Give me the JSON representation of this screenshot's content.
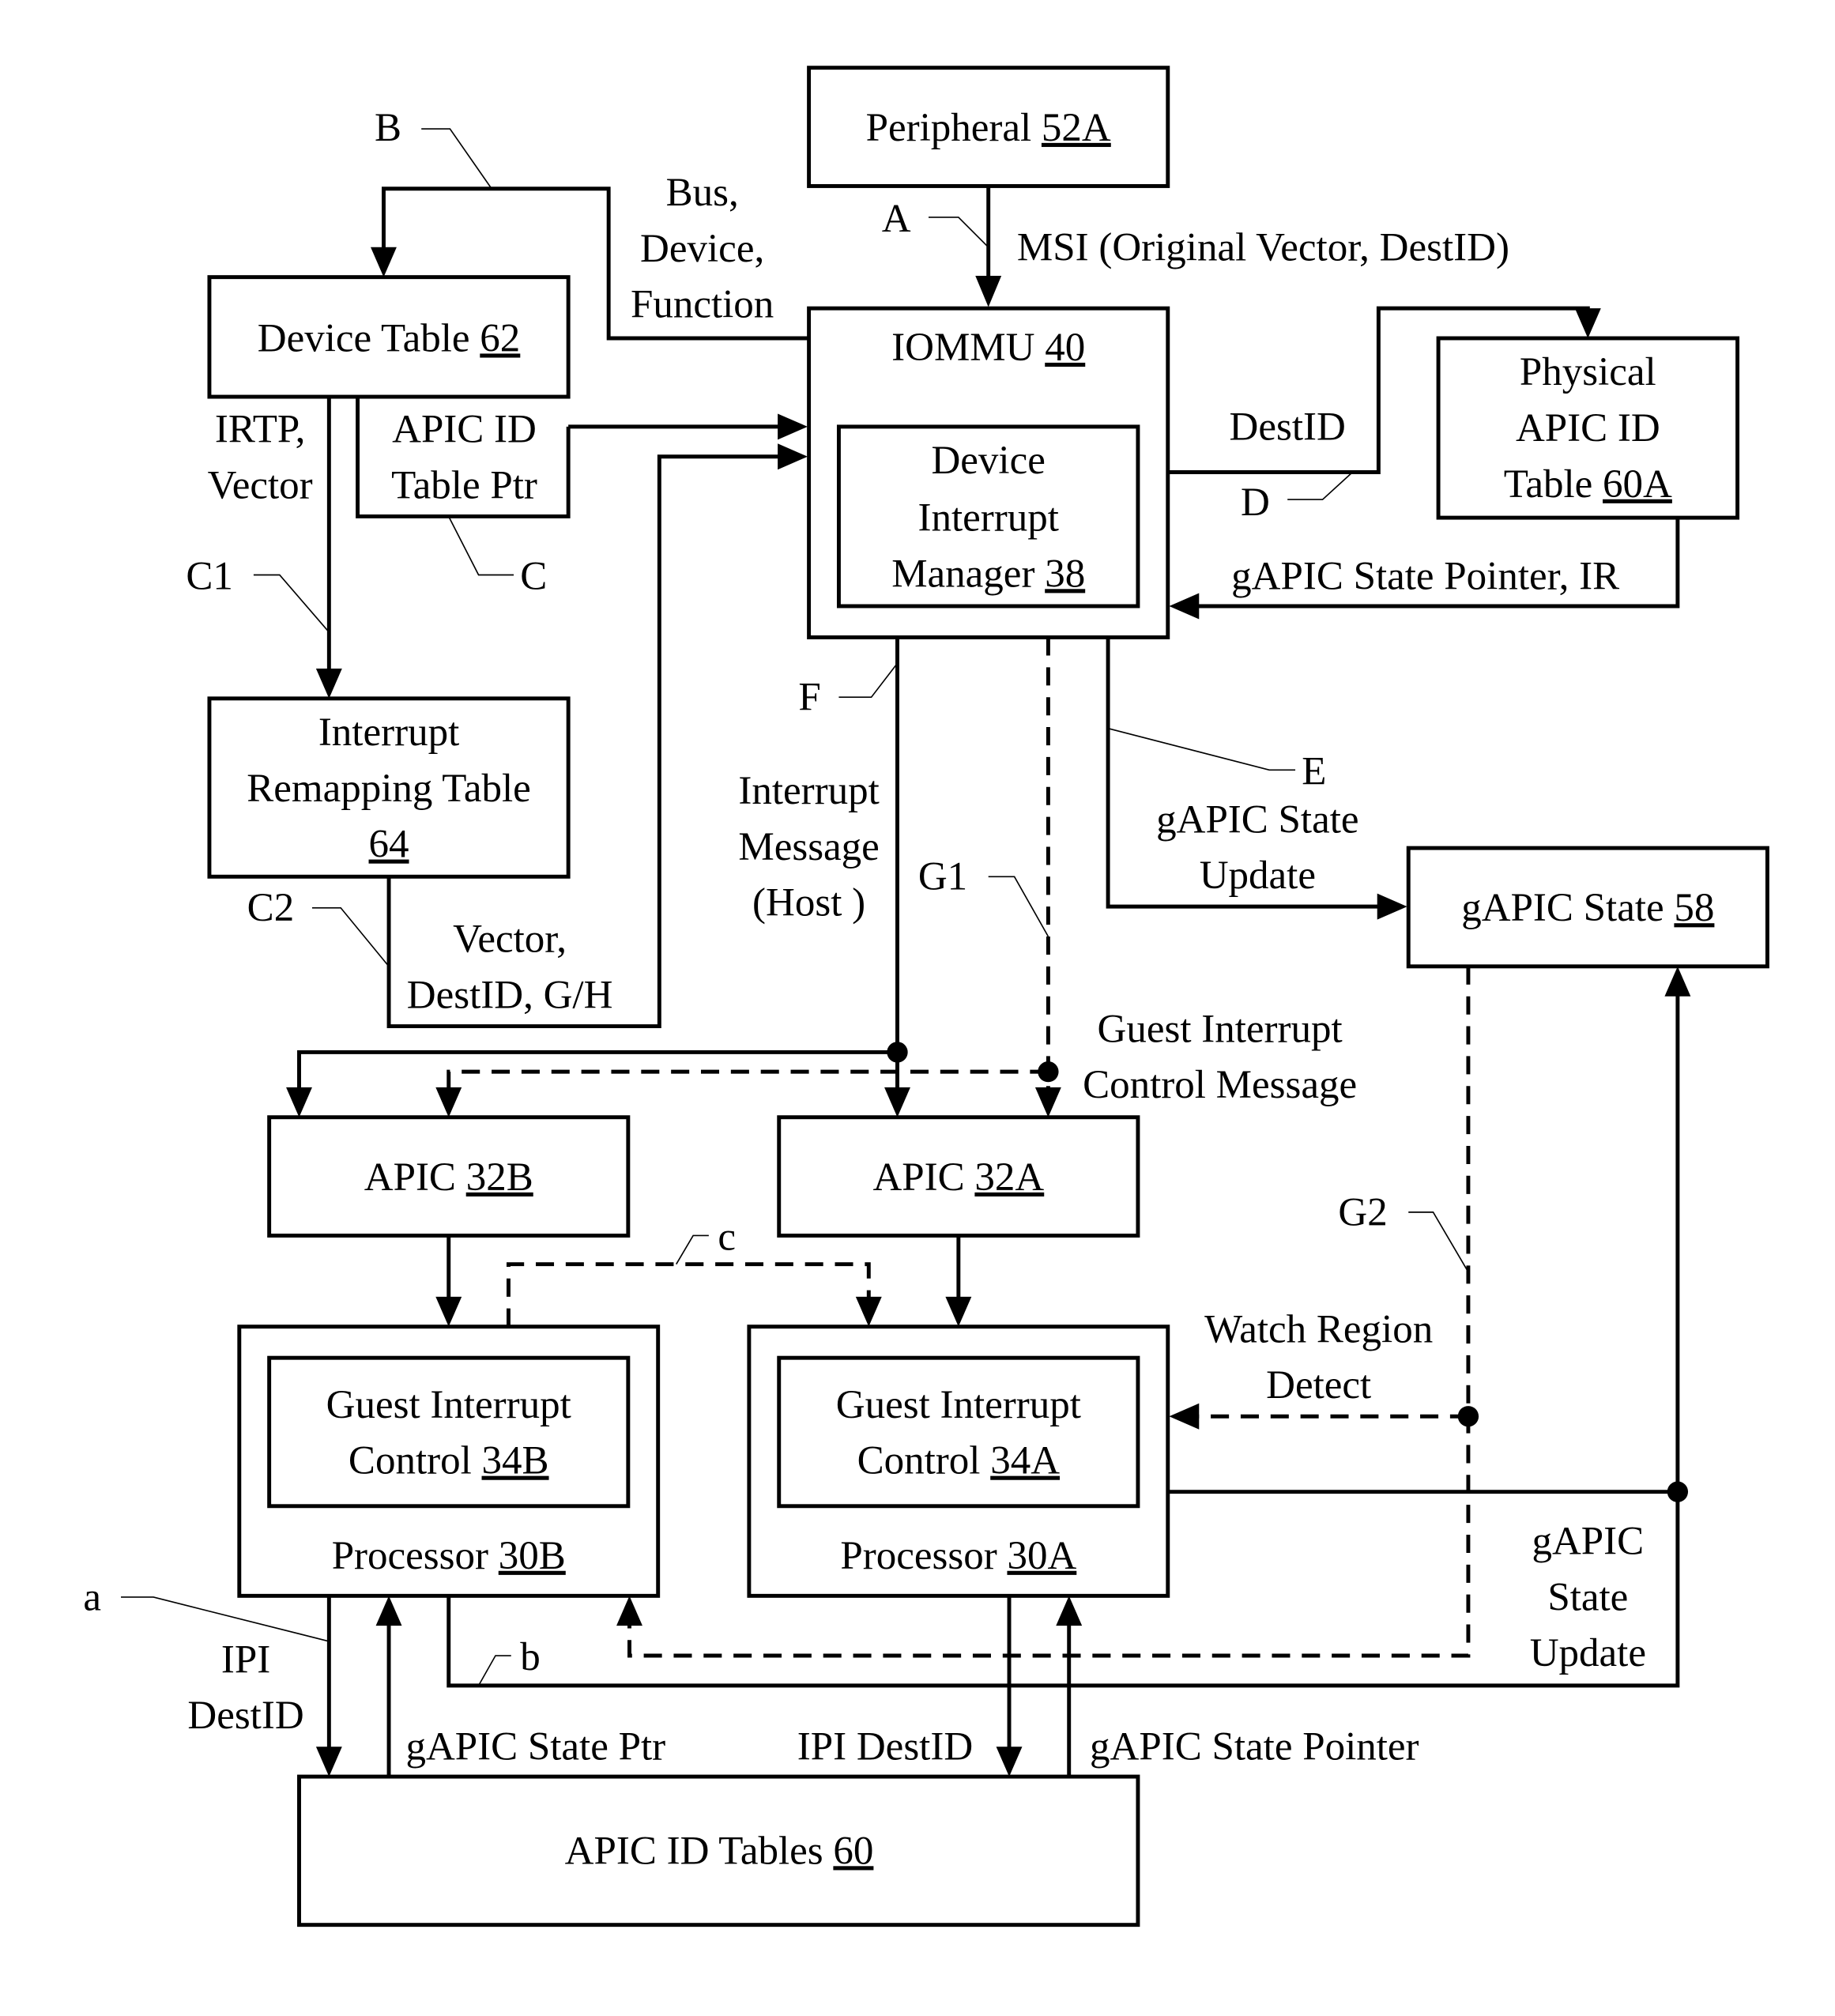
{
  "diagram": {
    "colors": {
      "stroke": "#000000",
      "background": "#ffffff"
    },
    "blocks": {
      "peripheral": {
        "label": "Peripheral ",
        "ref": "52A"
      },
      "iommu": {
        "label": "IOMMU ",
        "ref": "40"
      },
      "dim": {
        "line1": "Device",
        "line2": "Interrupt",
        "line3": "Manager ",
        "ref": "38"
      },
      "device_table": {
        "label": "Device Table ",
        "ref": "62"
      },
      "irt": {
        "line1": "Interrupt",
        "line2": "Remapping Table",
        "ref": "64"
      },
      "phys_apic": {
        "line1": "Physical",
        "line2": "APIC ID",
        "line3": "Table ",
        "ref": "60A"
      },
      "gapic_state": {
        "label": "gAPIC State ",
        "ref": "58"
      },
      "apic_b": {
        "label": "APIC ",
        "ref": "32B"
      },
      "apic_a": {
        "label": "APIC ",
        "ref": "32A"
      },
      "gic_b": {
        "line1": "Guest Interrupt",
        "line2": "Control ",
        "ref": "34B"
      },
      "gic_a": {
        "line1": "Guest Interrupt",
        "line2": "Control ",
        "ref": "34A"
      },
      "proc_b": {
        "label": "Processor ",
        "ref": "30B"
      },
      "proc_a": {
        "label": "Processor ",
        "ref": "30A"
      },
      "apic_id_tables": {
        "label": "APIC ID Tables ",
        "ref": "60"
      }
    },
    "signals": {
      "bdf": [
        "Bus,",
        "Device,",
        "Function"
      ],
      "msi": "MSI (Original Vector, DestID)",
      "irtp": [
        "IRTP,",
        "Vector"
      ],
      "apic_id_ptr": [
        "APIC  ID",
        "Table Ptr"
      ],
      "destid": "DestID",
      "gapic_ptr_ir": "gAPIC State Pointer, IR",
      "vec_dest_gh": [
        "Vector,",
        "DestID, G/H"
      ],
      "int_msg": [
        "Interrupt",
        "Message",
        "(Host )"
      ],
      "gapic_update_e": [
        "gAPIC State",
        "Update"
      ],
      "gic_msg": [
        "Guest Interrupt",
        "Control Message"
      ],
      "watch": [
        "Watch Region",
        "Detect"
      ],
      "gapic_update_b": [
        "gAPIC",
        "State",
        "Update"
      ],
      "ipi_b": [
        "IPI",
        "DestID"
      ],
      "gapic_ptr_b": "gAPIC State Ptr",
      "ipi_a": "IPI DestID",
      "gapic_ptr_a": "gAPIC State Pointer"
    },
    "callouts": {
      "A": "A",
      "B": "B",
      "C": "C",
      "C1": "C1",
      "C2": "C2",
      "D": "D",
      "E": "E",
      "F": "F",
      "G1": "G1",
      "G2": "G2",
      "a": "a",
      "b": "b",
      "c": "c"
    }
  }
}
